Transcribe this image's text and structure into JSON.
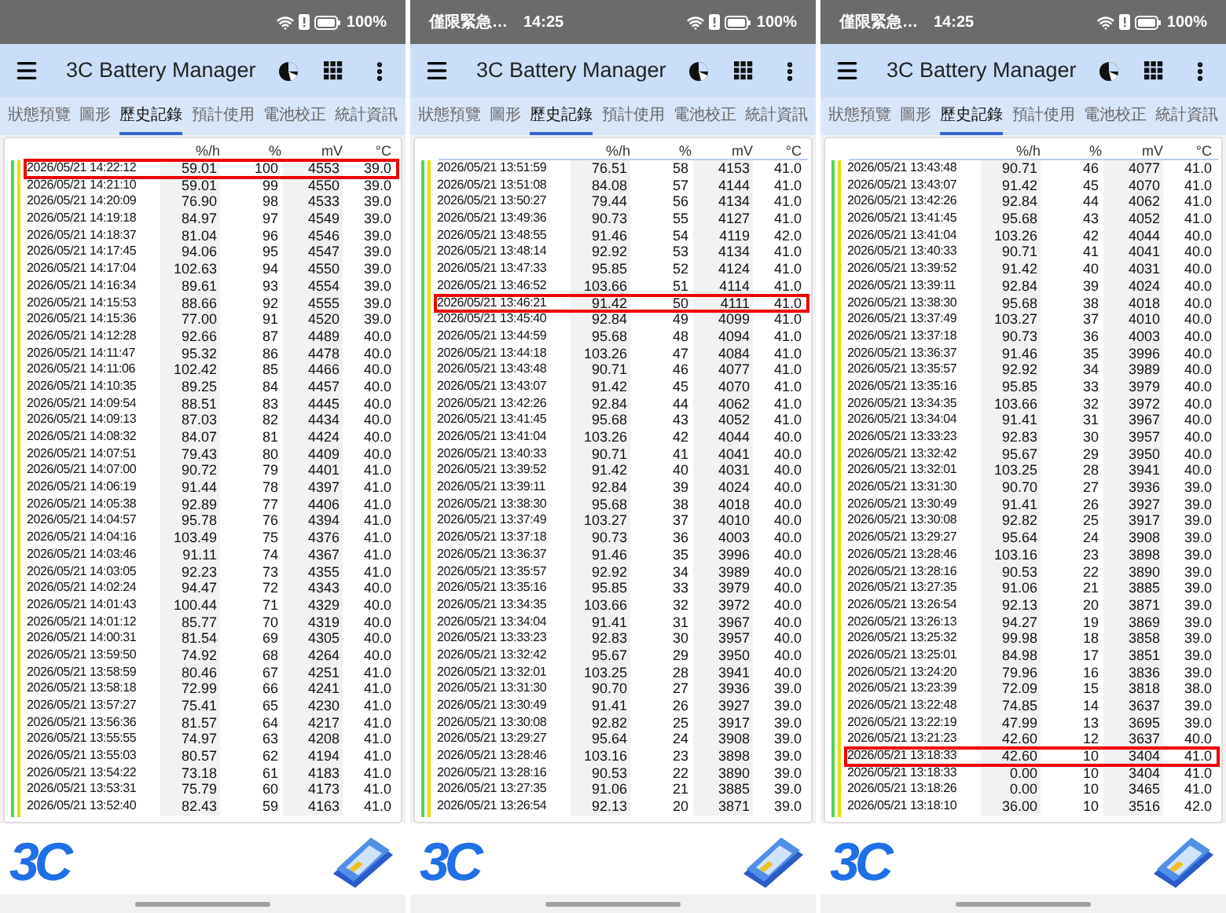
{
  "panels": [
    {
      "status_bar": {
        "battery": "100%"
      },
      "app_bar": {
        "title": "3C Battery Manager"
      },
      "tabs": [
        {
          "label": "狀態預覽",
          "selected": false
        },
        {
          "label": "圖形",
          "selected": false
        },
        {
          "label": "歷史記錄",
          "selected": true
        },
        {
          "label": "預計使用",
          "selected": false
        },
        {
          "label": "電池校正",
          "selected": false
        },
        {
          "label": "統計資訊",
          "selected": false
        }
      ],
      "table": {
        "columns": [
          "",
          "%/h",
          "%",
          "mV",
          "°C"
        ],
        "rows": [
          {
            "cells": [
              "2026/05/21 14:22:12",
              "59.01",
              "100",
              "4553",
              "39.0"
            ],
            "highlighted": true
          },
          {
            "cells": [
              "2026/05/21 14:21:10",
              "59.01",
              "99",
              "4550",
              "39.0"
            ],
            "highlighted": false
          },
          {
            "cells": [
              "2026/05/21 14:20:09",
              "76.90",
              "98",
              "4533",
              "39.0"
            ],
            "highlighted": false
          },
          {
            "cells": [
              "2026/05/21 14:19:18",
              "84.97",
              "97",
              "4549",
              "39.0"
            ],
            "highlighted": false
          },
          {
            "cells": [
              "2026/05/21 14:18:37",
              "81.04",
              "96",
              "4546",
              "39.0"
            ],
            "highlighted": false
          },
          {
            "cells": [
              "2026/05/21 14:17:45",
              "94.06",
              "95",
              "4547",
              "39.0"
            ],
            "highlighted": false
          },
          {
            "cells": [
              "2026/05/21 14:17:04",
              "102.63",
              "94",
              "4550",
              "39.0"
            ],
            "highlighted": false
          },
          {
            "cells": [
              "2026/05/21 14:16:34",
              "89.61",
              "93",
              "4554",
              "39.0"
            ],
            "highlighted": false
          },
          {
            "cells": [
              "2026/05/21 14:15:53",
              "88.66",
              "92",
              "4555",
              "39.0"
            ],
            "highlighted": false
          },
          {
            "cells": [
              "2026/05/21 14:15:36",
              "77.00",
              "91",
              "4520",
              "39.0"
            ],
            "highlighted": false
          },
          {
            "cells": [
              "2026/05/21 14:12:28",
              "92.66",
              "87",
              "4489",
              "40.0"
            ],
            "highlighted": false
          },
          {
            "cells": [
              "2026/05/21 14:11:47",
              "95.32",
              "86",
              "4478",
              "40.0"
            ],
            "highlighted": false
          },
          {
            "cells": [
              "2026/05/21 14:11:06",
              "102.42",
              "85",
              "4466",
              "40.0"
            ],
            "highlighted": false
          },
          {
            "cells": [
              "2026/05/21 14:10:35",
              "89.25",
              "84",
              "4457",
              "40.0"
            ],
            "highlighted": false
          },
          {
            "cells": [
              "2026/05/21 14:09:54",
              "88.51",
              "83",
              "4445",
              "40.0"
            ],
            "highlighted": false
          },
          {
            "cells": [
              "2026/05/21 14:09:13",
              "87.03",
              "82",
              "4434",
              "40.0"
            ],
            "highlighted": false
          },
          {
            "cells": [
              "2026/05/21 14:08:32",
              "84.07",
              "81",
              "4424",
              "40.0"
            ],
            "highlighted": false
          },
          {
            "cells": [
              "2026/05/21 14:07:51",
              "79.43",
              "80",
              "4409",
              "40.0"
            ],
            "highlighted": false
          },
          {
            "cells": [
              "2026/05/21 14:07:00",
              "90.72",
              "79",
              "4401",
              "41.0"
            ],
            "highlighted": false
          },
          {
            "cells": [
              "2026/05/21 14:06:19",
              "91.44",
              "78",
              "4397",
              "41.0"
            ],
            "highlighted": false
          },
          {
            "cells": [
              "2026/05/21 14:05:38",
              "92.89",
              "77",
              "4406",
              "41.0"
            ],
            "highlighted": false
          },
          {
            "cells": [
              "2026/05/21 14:04:57",
              "95.78",
              "76",
              "4394",
              "41.0"
            ],
            "highlighted": false
          },
          {
            "cells": [
              "2026/05/21 14:04:16",
              "103.49",
              "75",
              "4376",
              "41.0"
            ],
            "highlighted": false
          },
          {
            "cells": [
              "2026/05/21 14:03:46",
              "91.11",
              "74",
              "4367",
              "41.0"
            ],
            "highlighted": false
          },
          {
            "cells": [
              "2026/05/21 14:03:05",
              "92.23",
              "73",
              "4355",
              "41.0"
            ],
            "highlighted": false
          },
          {
            "cells": [
              "2026/05/21 14:02:24",
              "94.47",
              "72",
              "4343",
              "40.0"
            ],
            "highlighted": false
          },
          {
            "cells": [
              "2026/05/21 14:01:43",
              "100.44",
              "71",
              "4329",
              "40.0"
            ],
            "highlighted": false
          },
          {
            "cells": [
              "2026/05/21 14:01:12",
              "85.77",
              "70",
              "4319",
              "40.0"
            ],
            "highlighted": false
          },
          {
            "cells": [
              "2026/05/21 14:00:31",
              "81.54",
              "69",
              "4305",
              "40.0"
            ],
            "highlighted": false
          },
          {
            "cells": [
              "2026/05/21 13:59:50",
              "74.92",
              "68",
              "4264",
              "40.0"
            ],
            "highlighted": false
          },
          {
            "cells": [
              "2026/05/21 13:58:59",
              "80.46",
              "67",
              "4251",
              "41.0"
            ],
            "highlighted": false
          },
          {
            "cells": [
              "2026/05/21 13:58:18",
              "72.99",
              "66",
              "4241",
              "41.0"
            ],
            "highlighted": false
          },
          {
            "cells": [
              "2026/05/21 13:57:27",
              "75.41",
              "65",
              "4230",
              "41.0"
            ],
            "highlighted": false
          },
          {
            "cells": [
              "2026/05/21 13:56:36",
              "81.57",
              "64",
              "4217",
              "41.0"
            ],
            "highlighted": false
          },
          {
            "cells": [
              "2026/05/21 13:55:55",
              "74.97",
              "63",
              "4208",
              "41.0"
            ],
            "highlighted": false
          },
          {
            "cells": [
              "2026/05/21 13:55:03",
              "80.57",
              "62",
              "4194",
              "41.0"
            ],
            "highlighted": false
          },
          {
            "cells": [
              "2026/05/21 13:54:22",
              "73.18",
              "61",
              "4183",
              "41.0"
            ],
            "highlighted": false
          },
          {
            "cells": [
              "2026/05/21 13:53:31",
              "75.79",
              "60",
              "4173",
              "41.0"
            ],
            "highlighted": false
          },
          {
            "cells": [
              "2026/05/21 13:52:40",
              "82.43",
              "59",
              "4163",
              "41.0"
            ],
            "highlighted": false
          }
        ]
      },
      "footer": {
        "logo": "3C"
      }
    },
    {
      "status_bar": {
        "notification": "僅限緊急…",
        "time": "14:25",
        "battery": "100%"
      },
      "app_bar": {
        "title": "3C Battery Manager"
      },
      "tabs": [
        {
          "label": "狀態預覽",
          "selected": false
        },
        {
          "label": "圖形",
          "selected": false
        },
        {
          "label": "歷史記錄",
          "selected": true
        },
        {
          "label": "預計使用",
          "selected": false
        },
        {
          "label": "電池校正",
          "selected": false
        },
        {
          "label": "統計資訊",
          "selected": false
        }
      ],
      "table": {
        "columns": [
          "",
          "%/h",
          "%",
          "mV",
          "°C"
        ],
        "rows": [
          {
            "cells": [
              "2026/05/21 13:51:59",
              "76.51",
              "58",
              "4153",
              "41.0"
            ],
            "highlighted": false
          },
          {
            "cells": [
              "2026/05/21 13:51:08",
              "84.08",
              "57",
              "4144",
              "41.0"
            ],
            "highlighted": false
          },
          {
            "cells": [
              "2026/05/21 13:50:27",
              "79.44",
              "56",
              "4134",
              "41.0"
            ],
            "highlighted": false
          },
          {
            "cells": [
              "2026/05/21 13:49:36",
              "90.73",
              "55",
              "4127",
              "41.0"
            ],
            "highlighted": false
          },
          {
            "cells": [
              "2026/05/21 13:48:55",
              "91.46",
              "54",
              "4119",
              "42.0"
            ],
            "highlighted": false
          },
          {
            "cells": [
              "2026/05/21 13:48:14",
              "92.92",
              "53",
              "4134",
              "41.0"
            ],
            "highlighted": false
          },
          {
            "cells": [
              "2026/05/21 13:47:33",
              "95.85",
              "52",
              "4124",
              "41.0"
            ],
            "highlighted": false
          },
          {
            "cells": [
              "2026/05/21 13:46:52",
              "103.66",
              "51",
              "4114",
              "41.0"
            ],
            "highlighted": false
          },
          {
            "cells": [
              "2026/05/21 13:46:21",
              "91.42",
              "50",
              "4111",
              "41.0"
            ],
            "highlighted": true
          },
          {
            "cells": [
              "2026/05/21 13:45:40",
              "92.84",
              "49",
              "4099",
              "41.0"
            ],
            "highlighted": false
          },
          {
            "cells": [
              "2026/05/21 13:44:59",
              "95.68",
              "48",
              "4094",
              "41.0"
            ],
            "highlighted": false
          },
          {
            "cells": [
              "2026/05/21 13:44:18",
              "103.26",
              "47",
              "4084",
              "41.0"
            ],
            "highlighted": false
          },
          {
            "cells": [
              "2026/05/21 13:43:48",
              "90.71",
              "46",
              "4077",
              "41.0"
            ],
            "highlighted": false
          },
          {
            "cells": [
              "2026/05/21 13:43:07",
              "91.42",
              "45",
              "4070",
              "41.0"
            ],
            "highlighted": false
          },
          {
            "cells": [
              "2026/05/21 13:42:26",
              "92.84",
              "44",
              "4062",
              "41.0"
            ],
            "highlighted": false
          },
          {
            "cells": [
              "2026/05/21 13:41:45",
              "95.68",
              "43",
              "4052",
              "41.0"
            ],
            "highlighted": false
          },
          {
            "cells": [
              "2026/05/21 13:41:04",
              "103.26",
              "42",
              "4044",
              "40.0"
            ],
            "highlighted": false
          },
          {
            "cells": [
              "2026/05/21 13:40:33",
              "90.71",
              "41",
              "4041",
              "40.0"
            ],
            "highlighted": false
          },
          {
            "cells": [
              "2026/05/21 13:39:52",
              "91.42",
              "40",
              "4031",
              "40.0"
            ],
            "highlighted": false
          },
          {
            "cells": [
              "2026/05/21 13:39:11",
              "92.84",
              "39",
              "4024",
              "40.0"
            ],
            "highlighted": false
          },
          {
            "cells": [
              "2026/05/21 13:38:30",
              "95.68",
              "38",
              "4018",
              "40.0"
            ],
            "highlighted": false
          },
          {
            "cells": [
              "2026/05/21 13:37:49",
              "103.27",
              "37",
              "4010",
              "40.0"
            ],
            "highlighted": false
          },
          {
            "cells": [
              "2026/05/21 13:37:18",
              "90.73",
              "36",
              "4003",
              "40.0"
            ],
            "highlighted": false
          },
          {
            "cells": [
              "2026/05/21 13:36:37",
              "91.46",
              "35",
              "3996",
              "40.0"
            ],
            "highlighted": false
          },
          {
            "cells": [
              "2026/05/21 13:35:57",
              "92.92",
              "34",
              "3989",
              "40.0"
            ],
            "highlighted": false
          },
          {
            "cells": [
              "2026/05/21 13:35:16",
              "95.85",
              "33",
              "3979",
              "40.0"
            ],
            "highlighted": false
          },
          {
            "cells": [
              "2026/05/21 13:34:35",
              "103.66",
              "32",
              "3972",
              "40.0"
            ],
            "highlighted": false
          },
          {
            "cells": [
              "2026/05/21 13:34:04",
              "91.41",
              "31",
              "3967",
              "40.0"
            ],
            "highlighted": false
          },
          {
            "cells": [
              "2026/05/21 13:33:23",
              "92.83",
              "30",
              "3957",
              "40.0"
            ],
            "highlighted": false
          },
          {
            "cells": [
              "2026/05/21 13:32:42",
              "95.67",
              "29",
              "3950",
              "40.0"
            ],
            "highlighted": false
          },
          {
            "cells": [
              "2026/05/21 13:32:01",
              "103.25",
              "28",
              "3941",
              "40.0"
            ],
            "highlighted": false
          },
          {
            "cells": [
              "2026/05/21 13:31:30",
              "90.70",
              "27",
              "3936",
              "39.0"
            ],
            "highlighted": false
          },
          {
            "cells": [
              "2026/05/21 13:30:49",
              "91.41",
              "26",
              "3927",
              "39.0"
            ],
            "highlighted": false
          },
          {
            "cells": [
              "2026/05/21 13:30:08",
              "92.82",
              "25",
              "3917",
              "39.0"
            ],
            "highlighted": false
          },
          {
            "cells": [
              "2026/05/21 13:29:27",
              "95.64",
              "24",
              "3908",
              "39.0"
            ],
            "highlighted": false
          },
          {
            "cells": [
              "2026/05/21 13:28:46",
              "103.16",
              "23",
              "3898",
              "39.0"
            ],
            "highlighted": false
          },
          {
            "cells": [
              "2026/05/21 13:28:16",
              "90.53",
              "22",
              "3890",
              "39.0"
            ],
            "highlighted": false
          },
          {
            "cells": [
              "2026/05/21 13:27:35",
              "91.06",
              "21",
              "3885",
              "39.0"
            ],
            "highlighted": false
          },
          {
            "cells": [
              "2026/05/21 13:26:54",
              "92.13",
              "20",
              "3871",
              "39.0"
            ],
            "highlighted": false
          }
        ]
      },
      "footer": {
        "logo": "3C"
      }
    },
    {
      "status_bar": {
        "notification": "僅限緊急…",
        "time": "14:25",
        "battery": "100%"
      },
      "app_bar": {
        "title": "3C Battery Manager"
      },
      "tabs": [
        {
          "label": "狀態預覽",
          "selected": false
        },
        {
          "label": "圖形",
          "selected": false
        },
        {
          "label": "歷史記錄",
          "selected": true
        },
        {
          "label": "預計使用",
          "selected": false
        },
        {
          "label": "電池校正",
          "selected": false
        },
        {
          "label": "統計資訊",
          "selected": false
        }
      ],
      "table": {
        "columns": [
          "",
          "%/h",
          "%",
          "mV",
          "°C"
        ],
        "rows": [
          {
            "cells": [
              "2026/05/21 13:43:48",
              "90.71",
              "46",
              "4077",
              "41.0"
            ],
            "highlighted": false
          },
          {
            "cells": [
              "2026/05/21 13:43:07",
              "91.42",
              "45",
              "4070",
              "41.0"
            ],
            "highlighted": false
          },
          {
            "cells": [
              "2026/05/21 13:42:26",
              "92.84",
              "44",
              "4062",
              "41.0"
            ],
            "highlighted": false
          },
          {
            "cells": [
              "2026/05/21 13:41:45",
              "95.68",
              "43",
              "4052",
              "41.0"
            ],
            "highlighted": false
          },
          {
            "cells": [
              "2026/05/21 13:41:04",
              "103.26",
              "42",
              "4044",
              "40.0"
            ],
            "highlighted": false
          },
          {
            "cells": [
              "2026/05/21 13:40:33",
              "90.71",
              "41",
              "4041",
              "40.0"
            ],
            "highlighted": false
          },
          {
            "cells": [
              "2026/05/21 13:39:52",
              "91.42",
              "40",
              "4031",
              "40.0"
            ],
            "highlighted": false
          },
          {
            "cells": [
              "2026/05/21 13:39:11",
              "92.84",
              "39",
              "4024",
              "40.0"
            ],
            "highlighted": false
          },
          {
            "cells": [
              "2026/05/21 13:38:30",
              "95.68",
              "38",
              "4018",
              "40.0"
            ],
            "highlighted": false
          },
          {
            "cells": [
              "2026/05/21 13:37:49",
              "103.27",
              "37",
              "4010",
              "40.0"
            ],
            "highlighted": false
          },
          {
            "cells": [
              "2026/05/21 13:37:18",
              "90.73",
              "36",
              "4003",
              "40.0"
            ],
            "highlighted": false
          },
          {
            "cells": [
              "2026/05/21 13:36:37",
              "91.46",
              "35",
              "3996",
              "40.0"
            ],
            "highlighted": false
          },
          {
            "cells": [
              "2026/05/21 13:35:57",
              "92.92",
              "34",
              "3989",
              "40.0"
            ],
            "highlighted": false
          },
          {
            "cells": [
              "2026/05/21 13:35:16",
              "95.85",
              "33",
              "3979",
              "40.0"
            ],
            "highlighted": false
          },
          {
            "cells": [
              "2026/05/21 13:34:35",
              "103.66",
              "32",
              "3972",
              "40.0"
            ],
            "highlighted": false
          },
          {
            "cells": [
              "2026/05/21 13:34:04",
              "91.41",
              "31",
              "3967",
              "40.0"
            ],
            "highlighted": false
          },
          {
            "cells": [
              "2026/05/21 13:33:23",
              "92.83",
              "30",
              "3957",
              "40.0"
            ],
            "highlighted": false
          },
          {
            "cells": [
              "2026/05/21 13:32:42",
              "95.67",
              "29",
              "3950",
              "40.0"
            ],
            "highlighted": false
          },
          {
            "cells": [
              "2026/05/21 13:32:01",
              "103.25",
              "28",
              "3941",
              "40.0"
            ],
            "highlighted": false
          },
          {
            "cells": [
              "2026/05/21 13:31:30",
              "90.70",
              "27",
              "3936",
              "39.0"
            ],
            "highlighted": false
          },
          {
            "cells": [
              "2026/05/21 13:30:49",
              "91.41",
              "26",
              "3927",
              "39.0"
            ],
            "highlighted": false
          },
          {
            "cells": [
              "2026/05/21 13:30:08",
              "92.82",
              "25",
              "3917",
              "39.0"
            ],
            "highlighted": false
          },
          {
            "cells": [
              "2026/05/21 13:29:27",
              "95.64",
              "24",
              "3908",
              "39.0"
            ],
            "highlighted": false
          },
          {
            "cells": [
              "2026/05/21 13:28:46",
              "103.16",
              "23",
              "3898",
              "39.0"
            ],
            "highlighted": false
          },
          {
            "cells": [
              "2026/05/21 13:28:16",
              "90.53",
              "22",
              "3890",
              "39.0"
            ],
            "highlighted": false
          },
          {
            "cells": [
              "2026/05/21 13:27:35",
              "91.06",
              "21",
              "3885",
              "39.0"
            ],
            "highlighted": false
          },
          {
            "cells": [
              "2026/05/21 13:26:54",
              "92.13",
              "20",
              "3871",
              "39.0"
            ],
            "highlighted": false
          },
          {
            "cells": [
              "2026/05/21 13:26:13",
              "94.27",
              "19",
              "3869",
              "39.0"
            ],
            "highlighted": false
          },
          {
            "cells": [
              "2026/05/21 13:25:32",
              "99.98",
              "18",
              "3858",
              "39.0"
            ],
            "highlighted": false
          },
          {
            "cells": [
              "2026/05/21 13:25:01",
              "84.98",
              "17",
              "3851",
              "39.0"
            ],
            "highlighted": false
          },
          {
            "cells": [
              "2026/05/21 13:24:20",
              "79.96",
              "16",
              "3836",
              "39.0"
            ],
            "highlighted": false
          },
          {
            "cells": [
              "2026/05/21 13:23:39",
              "72.09",
              "15",
              "3818",
              "38.0"
            ],
            "highlighted": false
          },
          {
            "cells": [
              "2026/05/21 13:22:48",
              "74.85",
              "14",
              "3637",
              "39.0"
            ],
            "highlighted": false
          },
          {
            "cells": [
              "2026/05/21 13:22:19",
              "47.99",
              "13",
              "3695",
              "39.0"
            ],
            "highlighted": false
          },
          {
            "cells": [
              "2026/05/21 13:21:23",
              "42.60",
              "12",
              "3637",
              "40.0"
            ],
            "highlighted": false
          },
          {
            "cells": [
              "2026/05/21 13:18:33",
              "42.60",
              "10",
              "3404",
              "41.0"
            ],
            "highlighted": true
          },
          {
            "cells": [
              "2026/05/21 13:18:33",
              "0.00",
              "10",
              "3404",
              "41.0"
            ],
            "highlighted": false
          },
          {
            "cells": [
              "2026/05/21 13:18:26",
              "0.00",
              "10",
              "3465",
              "41.0"
            ],
            "highlighted": false
          },
          {
            "cells": [
              "2026/05/21 13:18:10",
              "36.00",
              "10",
              "3516",
              "42.0"
            ],
            "highlighted": false
          }
        ]
      },
      "footer": {
        "logo": "3C"
      }
    }
  ]
}
